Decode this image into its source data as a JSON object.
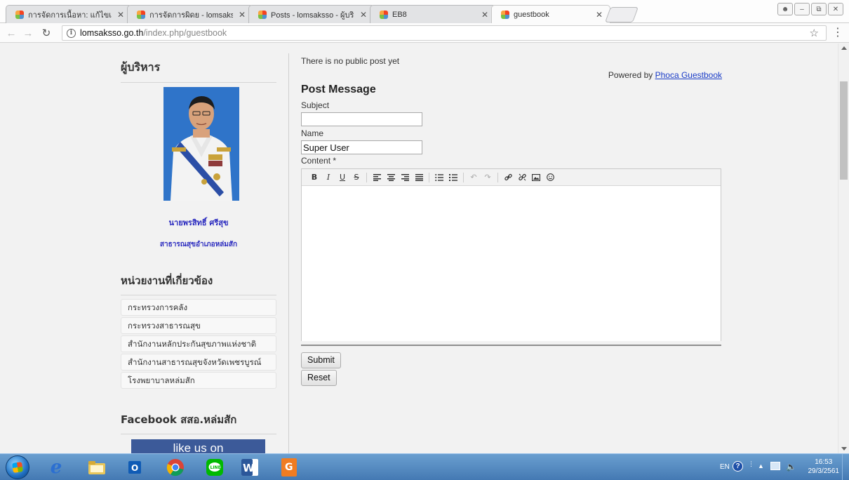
{
  "browser": {
    "tabs": [
      {
        "title": "การจัดการเนื้อหา: แก้ไขเนื้อ",
        "active": false
      },
      {
        "title": "การจัดการผิดย - lomsaks",
        "active": false
      },
      {
        "title": "Posts - lomsaksso - ผู้บริ",
        "active": false
      },
      {
        "title": "EB8",
        "active": false
      },
      {
        "title": "guestbook",
        "active": true
      }
    ],
    "url_domain": "lomsaksso.go.th",
    "url_path": "/index.php/guestbook"
  },
  "sidebar": {
    "executive_heading": "ผู้บริหาร",
    "admin_name": "นายพรสิทธิ์ ศรีสุข",
    "admin_title": "สาธารณสุขอำเภอหล่มสัก",
    "related_heading": "หน่วยงานที่เกี่ยวข้อง",
    "related_links": [
      "กระทรวงการคลัง",
      "กระทรวงสาธารณสุข",
      "สำนักงานหลักประกันสุขภาพแห่งชาติ",
      "สำนักงานสาธารณสุขจังหวัดเพชรบูรณ์",
      "โรงพยาบาลหล่มสัก"
    ],
    "facebook_heading": "Facebook สสอ.หล่มสัก",
    "like_box_text": "like us on"
  },
  "guestbook": {
    "no_post_text": "There is no public post yet",
    "powered_by_text": "Powered by ",
    "powered_by_link": "Phoca Guestbook",
    "post_heading": "Post Message",
    "subject_label": "Subject",
    "subject_value": "",
    "name_label": "Name",
    "name_value": "Super User",
    "content_label": "Content *",
    "submit_label": "Submit",
    "reset_label": "Reset"
  },
  "editor_toolbar": [
    "bold-icon",
    "italic-icon",
    "underline-icon",
    "strikethrough-icon",
    "align-left-icon",
    "align-center-icon",
    "align-right-icon",
    "align-justify-icon",
    "bullet-list-icon",
    "numbered-list-icon",
    "undo-icon",
    "redo-icon",
    "link-icon",
    "unlink-icon",
    "image-icon",
    "emoticon-icon"
  ],
  "taskbar": {
    "language": "EN",
    "time": "16:53",
    "date": "29/3/2561"
  },
  "colors": {
    "link": "#1a3cc7",
    "admin_name": "#2b2bbf",
    "taskbar": "#4f86c0",
    "facebook": "#3c5a99"
  }
}
